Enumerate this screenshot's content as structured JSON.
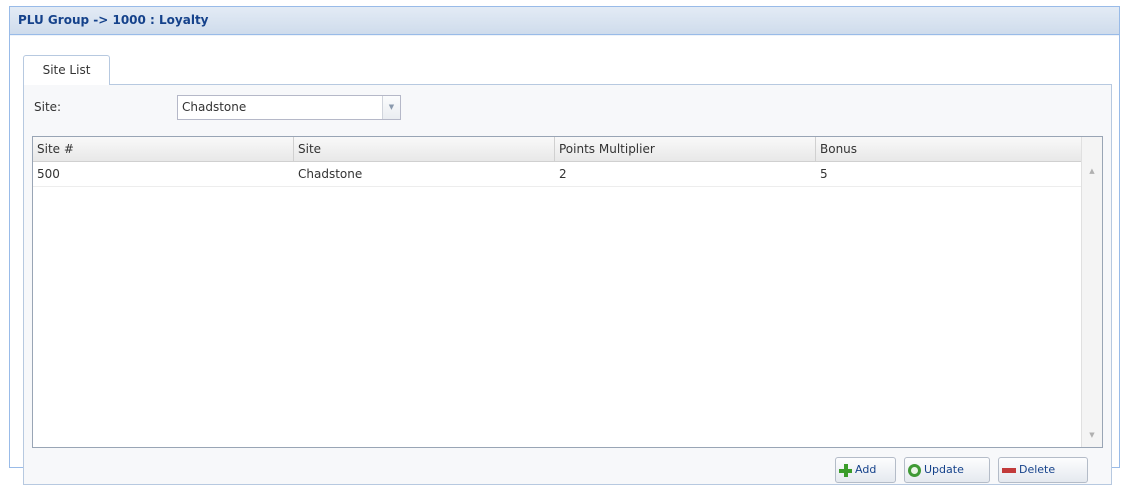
{
  "header": {
    "title": "PLU Group -> 1000 : Loyalty"
  },
  "tabs": [
    {
      "label": "Site List",
      "active": true
    }
  ],
  "site_filter": {
    "label": "Site:",
    "value": "Chadstone"
  },
  "grid": {
    "columns": [
      "Site #",
      "Site",
      "Points Multiplier",
      "Bonus"
    ],
    "rows": [
      {
        "site_no": "500",
        "site": "Chadstone",
        "points_multiplier": "2",
        "bonus": "5"
      }
    ]
  },
  "buttons": {
    "add": "Add",
    "update": "Update",
    "delete": "Delete"
  },
  "icons": {
    "add": "plus-icon",
    "update": "refresh-icon",
    "delete": "minus-icon"
  },
  "colors": {
    "header_text": "#15428b",
    "border": "#99bbe8",
    "add_icon": "#3a9c2a",
    "delete_icon": "#c23a3a"
  }
}
